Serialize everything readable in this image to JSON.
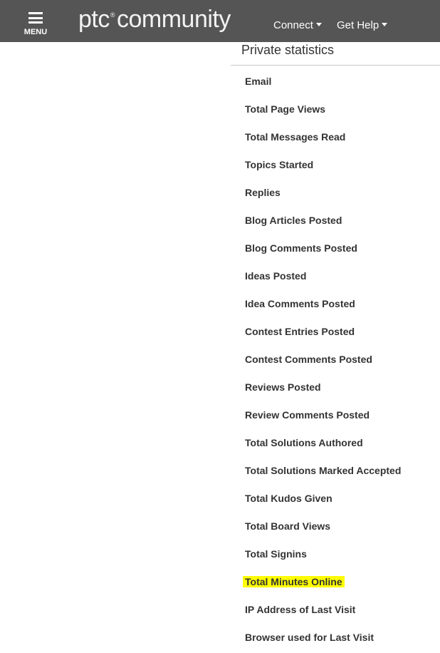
{
  "header": {
    "menu_label": "MENU",
    "logo_text_1": "ptc",
    "logo_reg": "®",
    "logo_text_2": "community",
    "nav": [
      {
        "label": "Connect"
      },
      {
        "label": "Get Help"
      }
    ]
  },
  "colors": {
    "header_bg": "#555555",
    "highlight": "#ffff00"
  },
  "section": {
    "title": "Private statistics",
    "items": [
      {
        "label": "Email"
      },
      {
        "label": "Total Page Views"
      },
      {
        "label": "Total Messages Read"
      },
      {
        "label": "Topics Started"
      },
      {
        "label": "Replies"
      },
      {
        "label": "Blog Articles Posted"
      },
      {
        "label": "Blog Comments Posted"
      },
      {
        "label": "Ideas Posted"
      },
      {
        "label": "Idea Comments Posted"
      },
      {
        "label": "Contest Entries Posted"
      },
      {
        "label": "Contest Comments Posted"
      },
      {
        "label": "Reviews Posted"
      },
      {
        "label": "Review Comments Posted"
      },
      {
        "label": "Total Solutions Authored"
      },
      {
        "label": "Total Solutions Marked Accepted"
      },
      {
        "label": "Total Kudos Given"
      },
      {
        "label": "Total Board Views"
      },
      {
        "label": "Total Signins"
      },
      {
        "label": "Total Minutes Online",
        "highlighted": true
      },
      {
        "label": "IP Address of Last Visit"
      },
      {
        "label": "Browser used for Last Visit"
      }
    ]
  }
}
